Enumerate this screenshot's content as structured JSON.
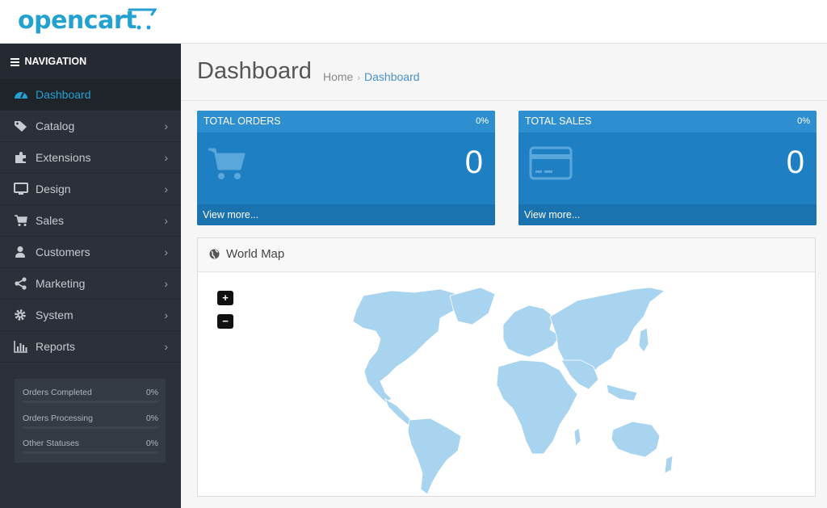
{
  "brand": {
    "logo_text": "opencart",
    "logo_color": "#23a1d1"
  },
  "sidebar": {
    "heading": "NAVIGATION",
    "items": [
      {
        "label": "Dashboard",
        "icon": "dashboard-icon",
        "active": true
      },
      {
        "label": "Catalog",
        "icon": "tag-icon"
      },
      {
        "label": "Extensions",
        "icon": "puzzle-icon"
      },
      {
        "label": "Design",
        "icon": "monitor-icon"
      },
      {
        "label": "Sales",
        "icon": "cart-icon"
      },
      {
        "label": "Customers",
        "icon": "user-icon"
      },
      {
        "label": "Marketing",
        "icon": "share-icon"
      },
      {
        "label": "System",
        "icon": "gear-icon"
      },
      {
        "label": "Reports",
        "icon": "bar-chart-icon"
      }
    ],
    "stats": [
      {
        "label": "Orders Completed",
        "value": "0%",
        "fraction": 0
      },
      {
        "label": "Orders Processing",
        "value": "0%",
        "fraction": 0
      },
      {
        "label": "Other Statuses",
        "value": "0%",
        "fraction": 0
      }
    ]
  },
  "page": {
    "title": "Dashboard",
    "breadcrumb": {
      "home": "Home",
      "separator": "›",
      "current": "Dashboard"
    }
  },
  "tiles": [
    {
      "title": "TOTAL ORDERS",
      "percent": "0%",
      "value": "0",
      "link": "View more...",
      "icon": "cart-icon"
    },
    {
      "title": "TOTAL SALES",
      "percent": "0%",
      "value": "0",
      "link": "View more...",
      "icon": "credit-card-icon"
    }
  ],
  "world_map": {
    "title": "World Map",
    "zoom_in": "+",
    "zoom_out": "−",
    "land_color": "#a8d4ef"
  },
  "colors": {
    "accent": "#1e7fc2",
    "sidebar_bg": "#2b3039"
  }
}
